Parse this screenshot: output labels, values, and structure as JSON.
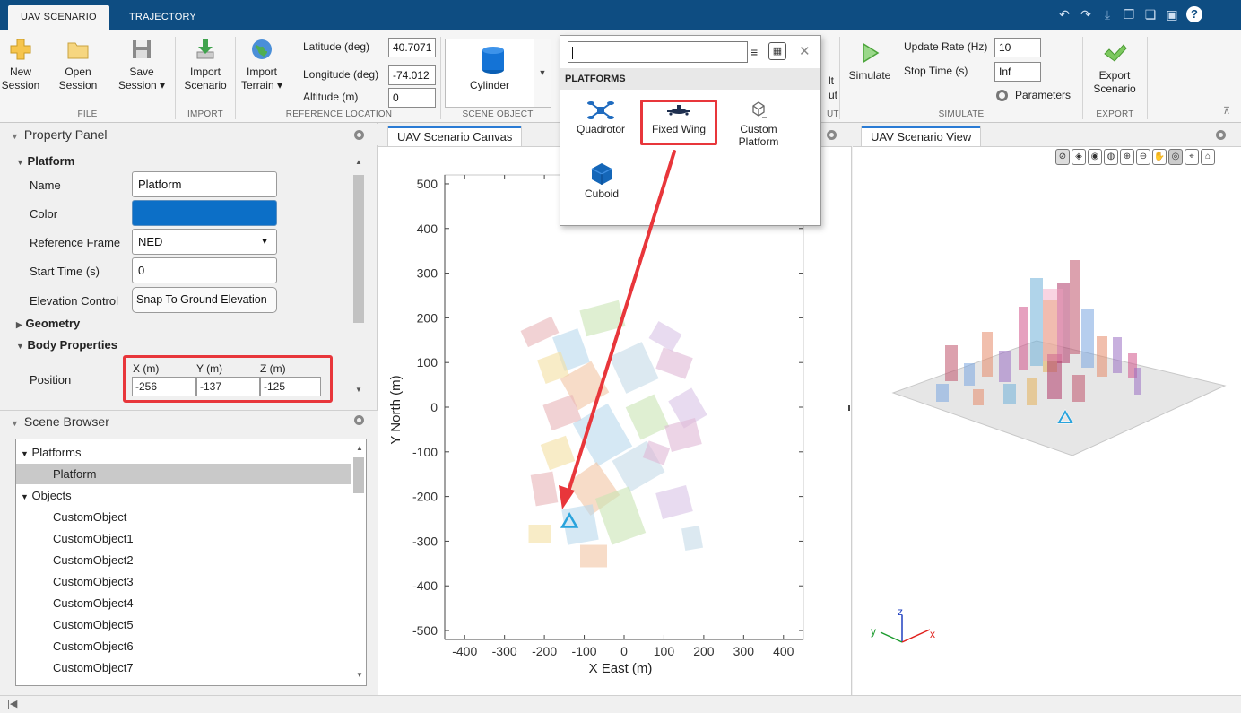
{
  "tabs": {
    "active": "UAV SCENARIO",
    "inactive": "TRAJECTORY"
  },
  "ribbon": {
    "new_session": "New Session",
    "open_session": "Open Session",
    "save_session": "Save Session",
    "import_scenario": "Import Scenario",
    "import_terrain": "Import Terrain",
    "latitude_label": "Latitude (deg)",
    "latitude_value": "40.7071",
    "longitude_label": "Longitude (deg)",
    "longitude_value": "-74.012",
    "altitude_label": "Altitude (m)",
    "altitude_value": "0",
    "scene_object": "Cylinder",
    "partial_lines": [
      "lt",
      "ut"
    ],
    "simulate": "Simulate",
    "update_rate_label": "Update Rate (Hz)",
    "update_rate_value": "10",
    "stop_time_label": "Stop Time (s)",
    "stop_time_value": "Inf",
    "parameters": "Parameters",
    "export_scenario": "Export Scenario",
    "sections": {
      "file": "FILE",
      "import": "IMPORT",
      "reference": "REFERENCE LOCATION",
      "scene_object": "SCENE OBJECT",
      "out_partial": "UT",
      "simulate": "SIMULATE",
      "export": "EXPORT"
    }
  },
  "platforms_popup": {
    "search_value": "",
    "header": "PLATFORMS",
    "items": [
      "Quadrotor",
      "Fixed Wing",
      "Custom Platform",
      "Cuboid"
    ]
  },
  "property_panel": {
    "title": "Property Panel",
    "platform_section": "Platform",
    "name_label": "Name",
    "name_value": "Platform",
    "color_label": "Color",
    "color_value": "#0c6fc7",
    "ref_frame_label": "Reference Frame",
    "ref_frame_value": "NED",
    "start_time_label": "Start Time (s)",
    "start_time_value": "0",
    "elevation_label": "Elevation Control",
    "elevation_value": "Snap To Ground Elevation",
    "geometry_section": "Geometry",
    "body_section": "Body Properties",
    "position_label": "Position",
    "pos_x_label": "X (m)",
    "pos_x_value": "-256",
    "pos_y_label": "Y (m)",
    "pos_y_value": "-137",
    "pos_z_label": "Z (m)",
    "pos_z_value": "-125"
  },
  "scene_browser": {
    "title": "Scene Browser",
    "platforms_group": "Platforms",
    "platform_item": "Platform",
    "objects_group": "Objects",
    "objects": [
      "CustomObject",
      "CustomObject1",
      "CustomObject2",
      "CustomObject3",
      "CustomObject4",
      "CustomObject5",
      "CustomObject6",
      "CustomObject7"
    ]
  },
  "canvas": {
    "tab": "UAV Scenario Canvas"
  },
  "view3d": {
    "tab": "UAV Scenario View",
    "axes": {
      "x": "x",
      "y": "y",
      "z": "z"
    }
  },
  "chart_data": {
    "type": "scatter",
    "title": "",
    "xlabel": "X East (m)",
    "ylabel": "Y North (m)",
    "xlim": [
      -450,
      450
    ],
    "ylim": [
      -520,
      520
    ],
    "xticks": [
      -400,
      -300,
      -200,
      -100,
      0,
      100,
      200,
      300,
      400
    ],
    "yticks": [
      -500,
      -400,
      -300,
      -200,
      -100,
      0,
      100,
      200,
      300,
      400,
      500
    ],
    "series": [
      {
        "marker": "triangle",
        "x": [
          -137
        ],
        "y": [
          -256
        ],
        "color": "#29a3dc"
      }
    ]
  },
  "colors": {
    "accent": "#2a7bd4",
    "title_bar": "#0e4d82",
    "highlight": "#e8363b",
    "platform_marker": "#29a3dc"
  }
}
